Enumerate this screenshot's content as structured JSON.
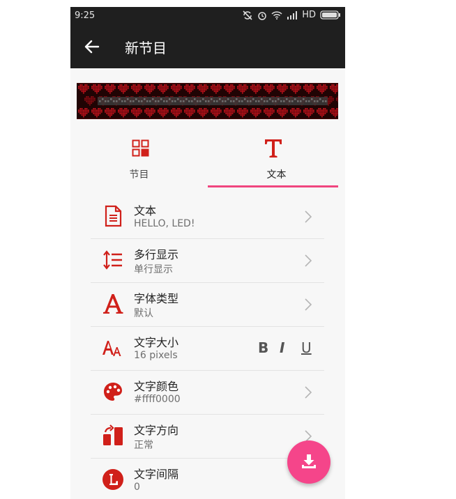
{
  "status_bar": {
    "time": "9:25",
    "network": "HD"
  },
  "app_bar": {
    "title": "新节目"
  },
  "tabs": [
    {
      "label": "节目",
      "icon": "grid-icon",
      "active": false
    },
    {
      "label": "文本",
      "icon": "text-t-icon",
      "active": true
    }
  ],
  "settings": [
    {
      "title": "文本",
      "value": "HELLO, LED!",
      "icon": "document-icon"
    },
    {
      "title": "多行显示",
      "value": "单行显示",
      "icon": "line-spacing-icon"
    },
    {
      "title": "字体类型",
      "value": "默认",
      "icon": "font-a-icon"
    },
    {
      "title": "文字大小",
      "value": "16 pixels",
      "icon": "font-size-icon"
    },
    {
      "title": "文字颜色",
      "value": "#ffff0000",
      "icon": "palette-icon"
    },
    {
      "title": "文字方向",
      "value": "正常",
      "icon": "rotate-icon"
    },
    {
      "title": "文字间隔",
      "value": "0",
      "icon": "letter-spacing-icon"
    }
  ],
  "format_buttons": {
    "bold": "B",
    "italic": "I",
    "underline": "U"
  },
  "colors": {
    "accent": "#f0457f",
    "icon_red": "#d0201a",
    "fab": "#f5458a",
    "appbar": "#1f1f1f"
  }
}
